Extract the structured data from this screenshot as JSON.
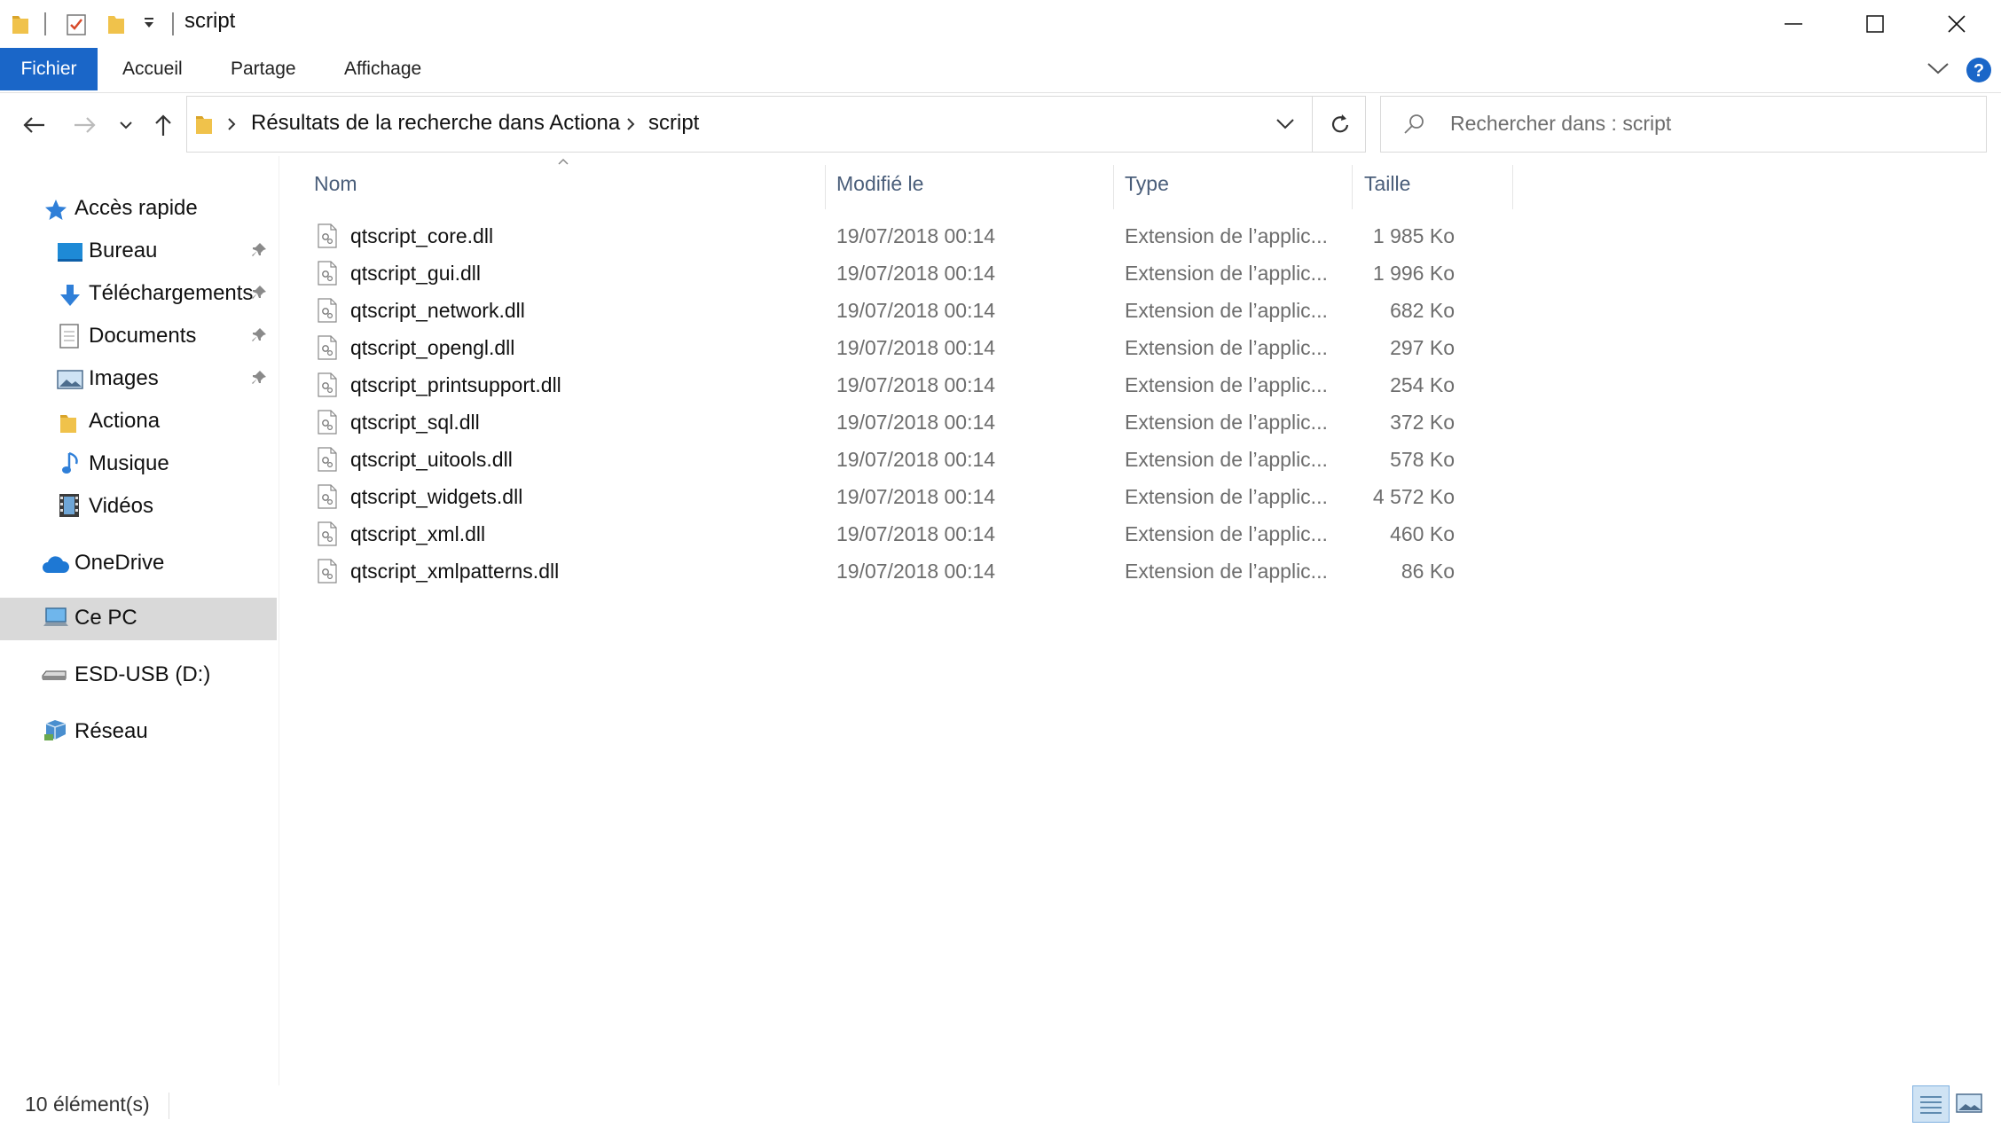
{
  "window": {
    "title": "script"
  },
  "ribbon": {
    "tabs": [
      "Fichier",
      "Accueil",
      "Partage",
      "Affichage"
    ]
  },
  "address": {
    "crumbs": [
      "Résultats de la recherche dans Actiona",
      "script"
    ]
  },
  "search": {
    "placeholder": "Rechercher dans : script"
  },
  "nav": {
    "quick_access": "Accès rapide",
    "items": [
      {
        "label": "Bureau",
        "icon": "desktop-icon",
        "pinned": true
      },
      {
        "label": "Téléchargements",
        "icon": "download-icon",
        "pinned": true
      },
      {
        "label": "Documents",
        "icon": "documents-icon",
        "pinned": true
      },
      {
        "label": "Images",
        "icon": "images-icon",
        "pinned": true
      },
      {
        "label": "Actiona",
        "icon": "folder-icon",
        "pinned": false
      },
      {
        "label": "Musique",
        "icon": "music-icon",
        "pinned": false
      },
      {
        "label": "Vidéos",
        "icon": "videos-icon",
        "pinned": false
      }
    ],
    "onedrive": "OneDrive",
    "this_pc": "Ce PC",
    "usb": "ESD-USB (D:)",
    "network": "Réseau"
  },
  "columns": {
    "name": "Nom",
    "modified": "Modifié le",
    "type": "Type",
    "size": "Taille"
  },
  "files": [
    {
      "name": "qtscript_core.dll",
      "modified": "19/07/2018 00:14",
      "type": "Extension de l’applic...",
      "size": "1 985 Ko"
    },
    {
      "name": "qtscript_gui.dll",
      "modified": "19/07/2018 00:14",
      "type": "Extension de l’applic...",
      "size": "1 996 Ko"
    },
    {
      "name": "qtscript_network.dll",
      "modified": "19/07/2018 00:14",
      "type": "Extension de l’applic...",
      "size": "682 Ko"
    },
    {
      "name": "qtscript_opengl.dll",
      "modified": "19/07/2018 00:14",
      "type": "Extension de l’applic...",
      "size": "297 Ko"
    },
    {
      "name": "qtscript_printsupport.dll",
      "modified": "19/07/2018 00:14",
      "type": "Extension de l’applic...",
      "size": "254 Ko"
    },
    {
      "name": "qtscript_sql.dll",
      "modified": "19/07/2018 00:14",
      "type": "Extension de l’applic...",
      "size": "372 Ko"
    },
    {
      "name": "qtscript_uitools.dll",
      "modified": "19/07/2018 00:14",
      "type": "Extension de l’applic...",
      "size": "578 Ko"
    },
    {
      "name": "qtscript_widgets.dll",
      "modified": "19/07/2018 00:14",
      "type": "Extension de l’applic...",
      "size": "4 572 Ko"
    },
    {
      "name": "qtscript_xml.dll",
      "modified": "19/07/2018 00:14",
      "type": "Extension de l’applic...",
      "size": "460 Ko"
    },
    {
      "name": "qtscript_xmlpatterns.dll",
      "modified": "19/07/2018 00:14",
      "type": "Extension de l’applic...",
      "size": "86 Ko"
    }
  ],
  "status": {
    "count": "10 élément(s)"
  },
  "colors": {
    "accent": "#1a66c8",
    "folder": "#f0c24b",
    "selected_bg": "#d9d9d9"
  }
}
